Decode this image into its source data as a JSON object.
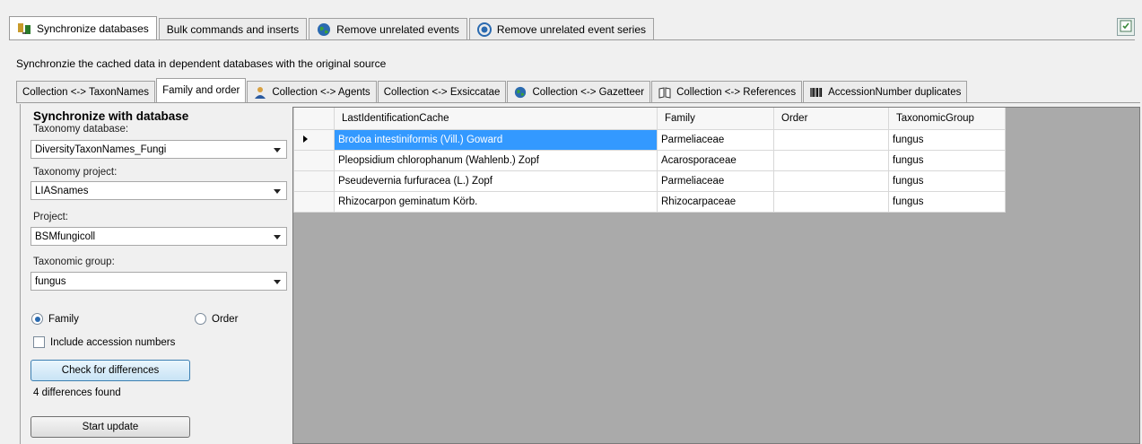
{
  "top_tabs": [
    {
      "label": "Synchronize databases",
      "icon": "sync-db-icon",
      "active": true
    },
    {
      "label": "Bulk commands and inserts",
      "icon": "",
      "active": false
    },
    {
      "label": "Remove unrelated events",
      "icon": "globe-icon",
      "active": false
    },
    {
      "label": "Remove unrelated event series",
      "icon": "globe-refresh-icon",
      "active": false
    }
  ],
  "subtitle": "Synchronzie the cached data in dependent databases with the original source",
  "inner_tabs": [
    {
      "label": "Collection <-> TaxonNames",
      "icon": "",
      "active": false
    },
    {
      "label": "Family and order",
      "icon": "",
      "active": true
    },
    {
      "label": "Collection <-> Agents",
      "icon": "person-icon",
      "active": false
    },
    {
      "label": "Collection <-> Exsiccatae",
      "icon": "",
      "active": false
    },
    {
      "label": "Collection <-> Gazetteer",
      "icon": "globe-icon",
      "active": false
    },
    {
      "label": "Collection <-> References",
      "icon": "book-icon",
      "active": false
    },
    {
      "label": "AccessionNumber duplicates",
      "icon": "barcode-icon",
      "active": false
    }
  ],
  "panel": {
    "heading": "Synchronize with database",
    "taxonomy_database_label": "Taxonomy database:",
    "taxonomy_database_value": "DiversityTaxonNames_Fungi",
    "taxonomy_project_label": "Taxonomy project:",
    "taxonomy_project_value": "LIASnames",
    "project_label": "Project:",
    "project_value": "BSMfungicoll",
    "taxonomic_group_label": "Taxonomic group:",
    "taxonomic_group_value": "fungus",
    "radio_family": "Family",
    "radio_order": "Order",
    "radio_selected": "Family",
    "include_accession": "Include accession numbers",
    "include_accession_checked": false,
    "check_button": "Check for differences",
    "status": "4 differences found",
    "start_button": "Start update"
  },
  "grid": {
    "columns": [
      "LastIdentificationCache",
      "Family",
      "Order",
      "TaxonomicGroup"
    ],
    "rows": [
      [
        "Brodoa intestiniformis (Vill.) Goward",
        "Parmeliaceae",
        "",
        "fungus"
      ],
      [
        "Pleopsidium chlorophanum (Wahlenb.) Zopf",
        "Acarosporaceae",
        "",
        "fungus"
      ],
      [
        "Pseudevernia furfuracea (L.) Zopf",
        "Parmeliaceae",
        "",
        "fungus"
      ],
      [
        "Rhizocarpon geminatum Körb.",
        "Rhizocarpaceae",
        "",
        "fungus"
      ]
    ],
    "selected_row": 0
  },
  "colors": {
    "selection": "#3399ff",
    "grid_background": "#aaaaaa",
    "window_background": "#f0f0f0"
  }
}
